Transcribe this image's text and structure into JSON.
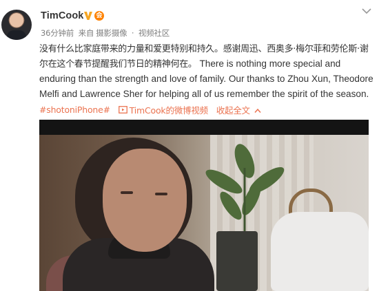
{
  "post": {
    "author": "TimCook",
    "verified_icon": "verified-v-icon",
    "vip_icon": "vip-badge-icon",
    "vip_text": "会",
    "meta": {
      "time": "36分钟前",
      "source_prefix": "来自",
      "source": "摄影摄像",
      "separator": "·",
      "community": "视频社区"
    },
    "text_cn": "没有什么比家庭带来的力量和爱更特别和持久。感谢周迅、西奥多·梅尔菲和劳伦斯·谢尔在这个春节提醒我们节日的精神何在。",
    "text_en": "There is nothing more special and enduring than the strength and love of family. Our thanks to Zhou Xun, Theodore Melfi and Lawrence Sher for helping all of us remember the spirit of the season.",
    "hashtag": "#shotoniPhone#",
    "video_link_label": "TimCook的微博视频",
    "collapse_label": "收起全文",
    "colors": {
      "link": "#eb7350",
      "meta": "#808080",
      "text": "#333333",
      "vip": "#ff8200",
      "verified": "#f6a623"
    }
  }
}
